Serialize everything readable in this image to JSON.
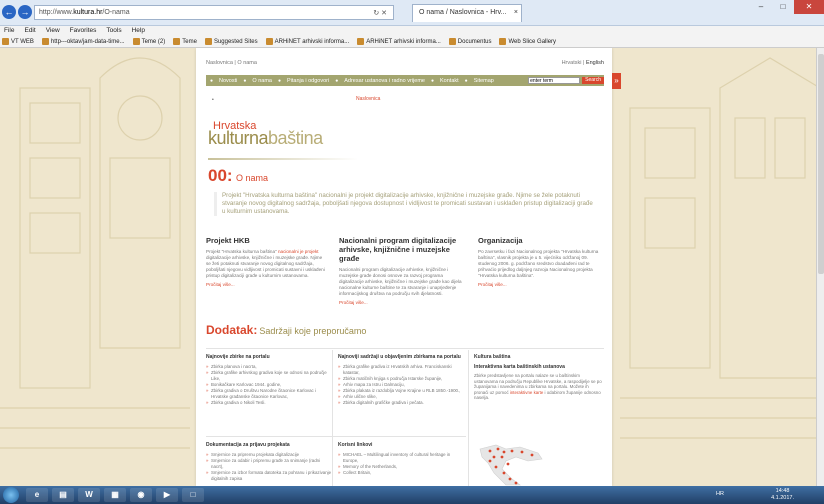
{
  "browser": {
    "address_prefix": "http://www.",
    "address_domain": "kultura.hr",
    "address_suffix": "/O-nama",
    "tab_title": "O nama / Naslovnica - Hrv...",
    "menu": [
      "File",
      "Edit",
      "View",
      "Favorites",
      "Tools",
      "Help"
    ],
    "favorites": [
      "VT WEB",
      "http---oktav/jam-data-time...",
      "Teme (2)",
      "Teme",
      "Suggested Sites",
      "ARHiNET arhivski informa...",
      "ARHiNET arhivski informa...",
      "Documentus",
      "Web Slice Gallery"
    ]
  },
  "site": {
    "top_links": "Naslovnica  |  O nama",
    "lang_hr": "Hrvatski",
    "lang_sep": " | ",
    "lang_en": "English",
    "nav": [
      "Novosti",
      "O nama",
      "Pitanja i odgovori",
      "Adresar ustanova i radno vrijeme",
      "Kontakt",
      "Sitemap"
    ],
    "search_value": "enter term",
    "search_button": "Search",
    "breadcrumb": "Naslovnica",
    "logo_top": "Hrvatska",
    "logo_bottom_a": "kulturna",
    "logo_bottom_b": "baština"
  },
  "main": {
    "page_number": "00:",
    "page_title": "O nama",
    "intro": "Projekt \"Hrvatska kulturna baština\" nacionalni je projekt digitalizacije arhivske, knjižnične i muzejske građe. Njime se žele potaknuti stvaranje novog digitalnog sadržaja, poboljšati njegova dostupnost i vidljivost te promicati sustavan i usklađen pristup digitalizaciji građe u kulturnim ustanovama.",
    "columns": [
      {
        "title": "Projekt HKB",
        "text_a": "Projekt \"Hrvatska kulturna baština\" ",
        "text_em": "nacionalni je projekt",
        "text_b": " digitalizacije arhivske, knjižnične i muzejske građe. Njime se žeti potaknuti stvaranje novog digitalnog sadržaja, poboljšati njegovu vidljivost i promicati sustavni i usklađeni pristup digitalizaciji građe u kulturnim ustanovama.",
        "more": "Pročitaj više..."
      },
      {
        "title": "Nacionalni program digitalizacije arhivske, knjižnične i muzejske građe",
        "text_a": "Nacionalni program digitalizacije arhivske, knjižnične i muzejske građe donosi osnove za razvoj programa digitalizacije arhivske, knjižnične i muzejske građe kao dijela nacionalne kulturne baštine te za stvaranje i unaprjeđenje informacijskog društva na području svih djelatnosti.",
        "text_em": "",
        "text_b": "",
        "more": "Pročitaj više..."
      },
      {
        "title": "Organizacija",
        "text_a": "Po zavrsetku i fazi Nacionalnog projekta \"Hrvatska kulturna baština\", vlasnik projekta je u 5. vijećniku održanoj 09. studenog 2006. g. podržano sredstvo doadađeni rad te prihvaćio prijedlog daljnjeg razvoja Nacionalnog projekta \"Hrvatska kulturna baština\".",
        "text_em": "",
        "text_b": "",
        "more": "Pročitaj više..."
      }
    ],
    "addon_label": "Dodatak:",
    "addon_title": "Sadržaji koje preporučamo",
    "boxes": [
      {
        "title": "Najnovije zbirke na portalu",
        "items": [
          "Zbirka planova i nacrta,",
          "Zbirka grafike arhivskog gradiva koje se odnosi na područje Like,",
          "Bonikačkare Karlovac 1944. godine,",
          "Zbirka gradiva o Društvu Narodne čitaonice Karlovac i Hrvatske građanske čitaonice Karlovac,",
          "Zbirka gradiva o Nikoli Tesli."
        ]
      },
      {
        "title": "Najnoviji sadržaji u objavljenim zbirkama na portalu",
        "items": [
          "Zbirka grafike gradiva iz Hrvatskih arhiva. Franciskanski katastar,",
          "Zbirka matičnih knjiga s područja Istarske županije,",
          "Arhiv mapa za Istru i Dalmaciju,",
          "Zbirka plakata iz razdoblja Vojne Krajine u RLB 1850.-1900.,",
          "Arhiv ulične slike,",
          "Zbirka digitalnih grafičke gradiva i pečata."
        ]
      },
      {
        "title": "Kultura baština",
        "sub": "Interaktivna karta baštinskih ustanova",
        "text_a": "Zbirke predstavljene na portalu nalaze se u baštinskim ustanovama na području Republike Hrvatske, a raspodijelje se po županijama i navedenima u zbirkama na portalu. Možete ih pronaći uz pomoć ",
        "text_em": "interaktivne karte",
        "text_b": " i odabirom županije odnosno naselja."
      },
      {
        "title": "Dokumentacija za prijavu projekata",
        "items": [
          "Smjernice za pripremu projekata digitalizacije",
          "Smjernice za odabir i pripremu građe za snimanje (radni nacrt),",
          "Smjernice za izbor formata datoteka za pohranu i prikazivanje digitalnih zapisa"
        ]
      },
      {
        "title": "Korisni linkovi",
        "items": [
          "MICHAEL – Multilingual inventory of cultural heritage in Europe,",
          "Memory of the Netherlands,",
          "Collect Britain,"
        ]
      }
    ]
  },
  "taskbar": {
    "word_label": "W",
    "lang": "HR",
    "time": "14:48",
    "date": "4.1.2017."
  }
}
